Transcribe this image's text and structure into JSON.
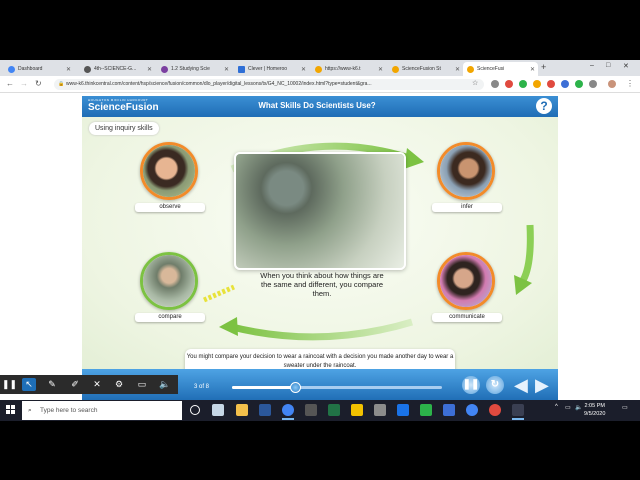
{
  "colors": {
    "brand_blue": "#1f6db5",
    "accent_orange": "#f28b2a",
    "accent_green": "#7cc242",
    "taskbar": "#1b1e2b"
  },
  "browser": {
    "tabs": [
      {
        "label": "Dashboard",
        "icon": "google-icon",
        "color": "#4285f4"
      },
      {
        "label": "4th--SCIENCE-G...",
        "icon": "page-icon",
        "color": "#555"
      },
      {
        "label": "1.2 Studying Scie",
        "icon": "page-icon",
        "color": "#7b3fa0"
      },
      {
        "label": "Clever | Homeroo",
        "icon": "clever-icon",
        "color": "#2f6fd6"
      },
      {
        "label": "https://www-k6.t",
        "icon": "page-icon",
        "color": "#f2a600"
      },
      {
        "label": "ScienceFusion St",
        "icon": "page-icon",
        "color": "#f2a600"
      },
      {
        "label": "ScienceFusi",
        "icon": "page-icon",
        "color": "#f2a600"
      }
    ],
    "url": "www-k6.thinkcentral.com/content/hsp/science/fusion/common/dlo_player/digital_lessons/tx/G4_NC_10002/index.html?type=student&gra..."
  },
  "app": {
    "logo": "ScienceFusion",
    "logo_sub": "HOUGHTON MIFFLIN HARCOURT",
    "title": "What Skills Do Scientists Use?",
    "help": "?",
    "section_label": "Using inquiry skills",
    "skills": {
      "observe": "observe",
      "infer": "infer",
      "compare": "compare",
      "communicate": "communicate"
    },
    "caption": "When you think about how things are the same and different, you compare them.",
    "info": "You might compare your decision to wear a raincoat with a decision you made another day to wear a sweater under the raincoat.",
    "page": "3 of 8",
    "progress": 0.3
  },
  "taskbar": {
    "search_placeholder": "Type here to search",
    "time": "2:05 PM",
    "date": "9/5/2020"
  }
}
